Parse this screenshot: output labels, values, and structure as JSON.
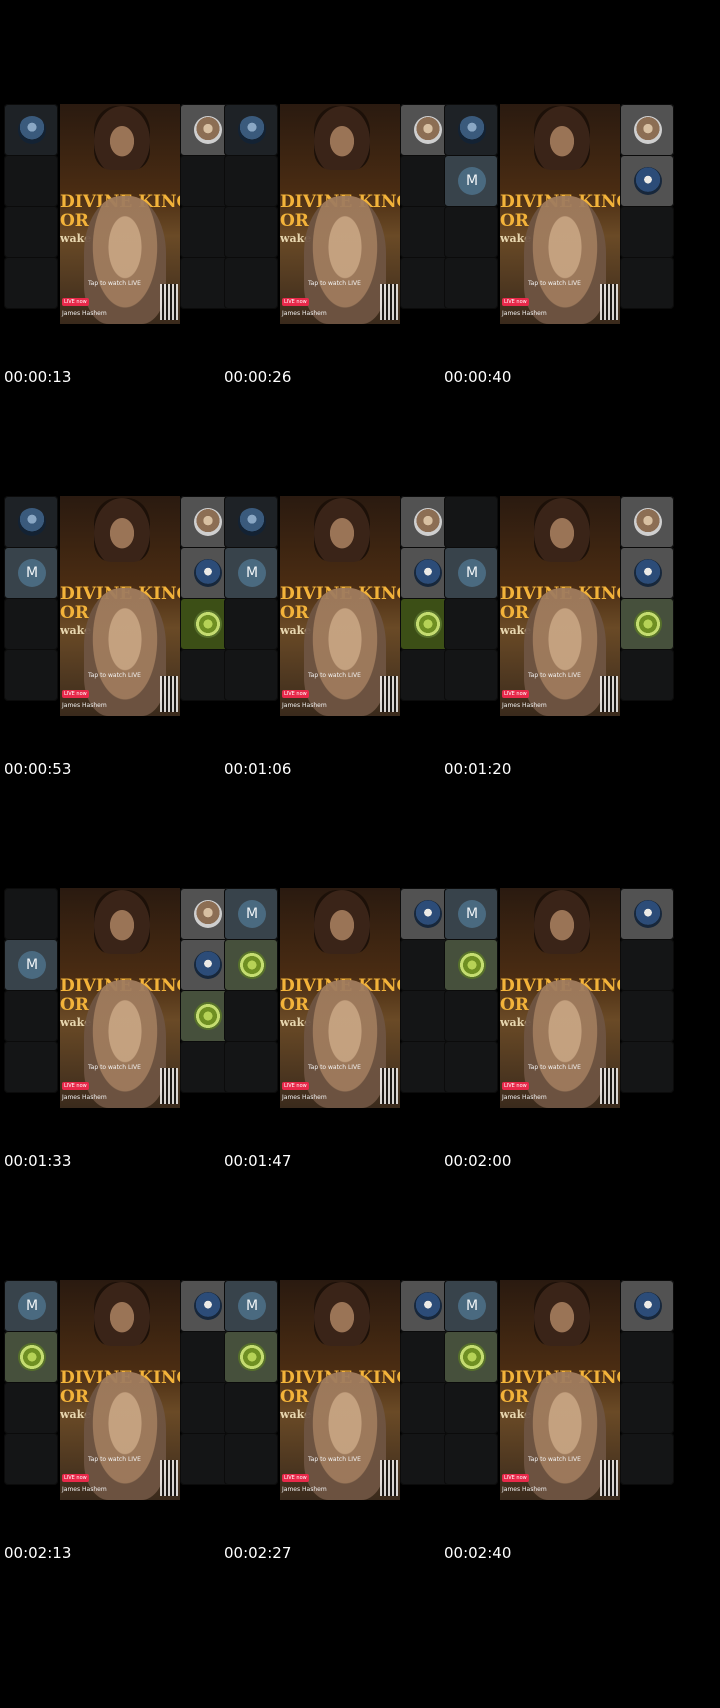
{
  "video_overlay": {
    "banner_line1": "DIVINE KING",
    "banner_line2": "OR",
    "banner_line3": "wake",
    "tap_text": "Tap to watch LIVE",
    "live_badge": "LIVE now",
    "host_name": "James Hashem"
  },
  "frames": [
    {
      "timestamp": "00:00:13",
      "left": [
        {
          "tile": "dark",
          "avatar": "a"
        },
        {
          "tile": "empty"
        },
        {
          "tile": "empty"
        },
        {
          "tile": "empty"
        }
      ],
      "right": [
        {
          "tile": "grey",
          "avatar": "b"
        },
        {
          "tile": "empty"
        },
        {
          "tile": "empty"
        },
        {
          "tile": "empty"
        }
      ]
    },
    {
      "timestamp": "00:00:26",
      "left": [
        {
          "tile": "dark",
          "avatar": "a"
        },
        {
          "tile": "empty"
        },
        {
          "tile": "empty"
        },
        {
          "tile": "empty"
        }
      ],
      "right": [
        {
          "tile": "grey",
          "avatar": "b"
        },
        {
          "tile": "empty"
        },
        {
          "tile": "empty"
        },
        {
          "tile": "empty"
        }
      ]
    },
    {
      "timestamp": "00:00:40",
      "left": [
        {
          "tile": "dark",
          "avatar": "a"
        },
        {
          "tile": "slate",
          "avatar": "m",
          "label": "M"
        },
        {
          "tile": "empty"
        },
        {
          "tile": "empty"
        }
      ],
      "right": [
        {
          "tile": "grey",
          "avatar": "b"
        },
        {
          "tile": "grey",
          "avatar": "c"
        },
        {
          "tile": "empty"
        },
        {
          "tile": "empty"
        }
      ]
    },
    {
      "timestamp": "00:00:53",
      "left": [
        {
          "tile": "dark",
          "avatar": "a"
        },
        {
          "tile": "slate",
          "avatar": "m",
          "label": "M"
        },
        {
          "tile": "empty"
        },
        {
          "tile": "empty"
        }
      ],
      "right": [
        {
          "tile": "grey",
          "avatar": "b"
        },
        {
          "tile": "grey",
          "avatar": "c"
        },
        {
          "tile": "green",
          "avatar": "g"
        },
        {
          "tile": "empty"
        }
      ]
    },
    {
      "timestamp": "00:01:06",
      "left": [
        {
          "tile": "dark",
          "avatar": "a"
        },
        {
          "tile": "slate",
          "avatar": "m",
          "label": "M"
        },
        {
          "tile": "empty"
        },
        {
          "tile": "empty"
        }
      ],
      "right": [
        {
          "tile": "grey",
          "avatar": "b"
        },
        {
          "tile": "grey",
          "avatar": "c"
        },
        {
          "tile": "green",
          "avatar": "g"
        },
        {
          "tile": "empty"
        }
      ]
    },
    {
      "timestamp": "00:01:20",
      "left": [
        {
          "tile": "empty"
        },
        {
          "tile": "slate",
          "avatar": "m",
          "label": "M"
        },
        {
          "tile": "empty"
        },
        {
          "tile": "empty"
        }
      ],
      "right": [
        {
          "tile": "grey",
          "avatar": "b"
        },
        {
          "tile": "grey",
          "avatar": "c"
        },
        {
          "tile": "olive",
          "avatar": "g"
        },
        {
          "tile": "empty"
        }
      ]
    },
    {
      "timestamp": "00:01:33",
      "left": [
        {
          "tile": "empty"
        },
        {
          "tile": "slate",
          "avatar": "m",
          "label": "M"
        },
        {
          "tile": "empty"
        },
        {
          "tile": "empty"
        }
      ],
      "right": [
        {
          "tile": "grey",
          "avatar": "b"
        },
        {
          "tile": "grey",
          "avatar": "c"
        },
        {
          "tile": "olive",
          "avatar": "g"
        },
        {
          "tile": "empty"
        }
      ]
    },
    {
      "timestamp": "00:01:47",
      "left": [
        {
          "tile": "slate",
          "avatar": "m",
          "label": "M"
        },
        {
          "tile": "olive",
          "avatar": "g"
        },
        {
          "tile": "empty"
        },
        {
          "tile": "empty"
        }
      ],
      "right": [
        {
          "tile": "grey",
          "avatar": "c"
        },
        {
          "tile": "empty"
        },
        {
          "tile": "empty"
        },
        {
          "tile": "empty"
        }
      ]
    },
    {
      "timestamp": "00:02:00",
      "left": [
        {
          "tile": "slate",
          "avatar": "m",
          "label": "M"
        },
        {
          "tile": "olive",
          "avatar": "g"
        },
        {
          "tile": "empty"
        },
        {
          "tile": "empty"
        }
      ],
      "right": [
        {
          "tile": "grey",
          "avatar": "c"
        },
        {
          "tile": "empty"
        },
        {
          "tile": "empty"
        },
        {
          "tile": "empty"
        }
      ]
    },
    {
      "timestamp": "00:02:13",
      "left": [
        {
          "tile": "slate",
          "avatar": "m",
          "label": "M"
        },
        {
          "tile": "olive",
          "avatar": "g"
        },
        {
          "tile": "empty"
        },
        {
          "tile": "empty"
        }
      ],
      "right": [
        {
          "tile": "grey",
          "avatar": "c"
        },
        {
          "tile": "empty"
        },
        {
          "tile": "empty"
        },
        {
          "tile": "empty"
        }
      ]
    },
    {
      "timestamp": "00:02:27",
      "left": [
        {
          "tile": "slate",
          "avatar": "m",
          "label": "M"
        },
        {
          "tile": "olive",
          "avatar": "g"
        },
        {
          "tile": "empty"
        },
        {
          "tile": "empty"
        }
      ],
      "right": [
        {
          "tile": "grey",
          "avatar": "c"
        },
        {
          "tile": "empty"
        },
        {
          "tile": "empty"
        },
        {
          "tile": "empty"
        }
      ]
    },
    {
      "timestamp": "00:02:40",
      "left": [
        {
          "tile": "slate",
          "avatar": "m",
          "label": "M"
        },
        {
          "tile": "olive",
          "avatar": "g"
        },
        {
          "tile": "empty"
        },
        {
          "tile": "empty"
        }
      ],
      "right": [
        {
          "tile": "grey",
          "avatar": "c"
        },
        {
          "tile": "empty"
        },
        {
          "tile": "empty"
        },
        {
          "tile": "empty"
        }
      ]
    }
  ]
}
